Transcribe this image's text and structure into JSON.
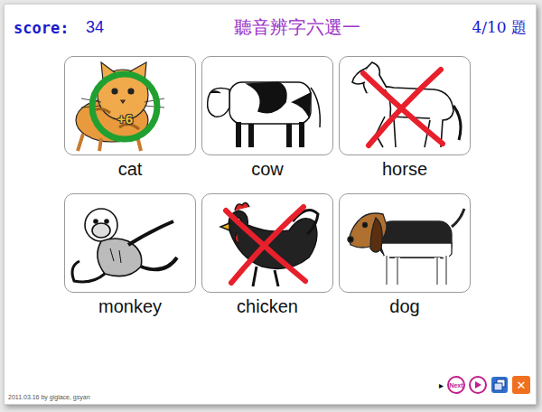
{
  "header": {
    "score_label": "score:",
    "score": "34",
    "title": "聽音辨字六選一",
    "progress": "4/10 題"
  },
  "cards": [
    {
      "label": "cat",
      "result": "correct",
      "badge": "+6"
    },
    {
      "label": "cow",
      "result": "none"
    },
    {
      "label": "horse",
      "result": "wrong"
    },
    {
      "label": "monkey",
      "result": "none"
    },
    {
      "label": "chicken",
      "result": "wrong"
    },
    {
      "label": "dog",
      "result": "none"
    }
  ],
  "toolbar": {
    "expand": "▸",
    "next": "Next",
    "close": "✕"
  },
  "footer": "2011.03.16 by giglace, gsyan"
}
